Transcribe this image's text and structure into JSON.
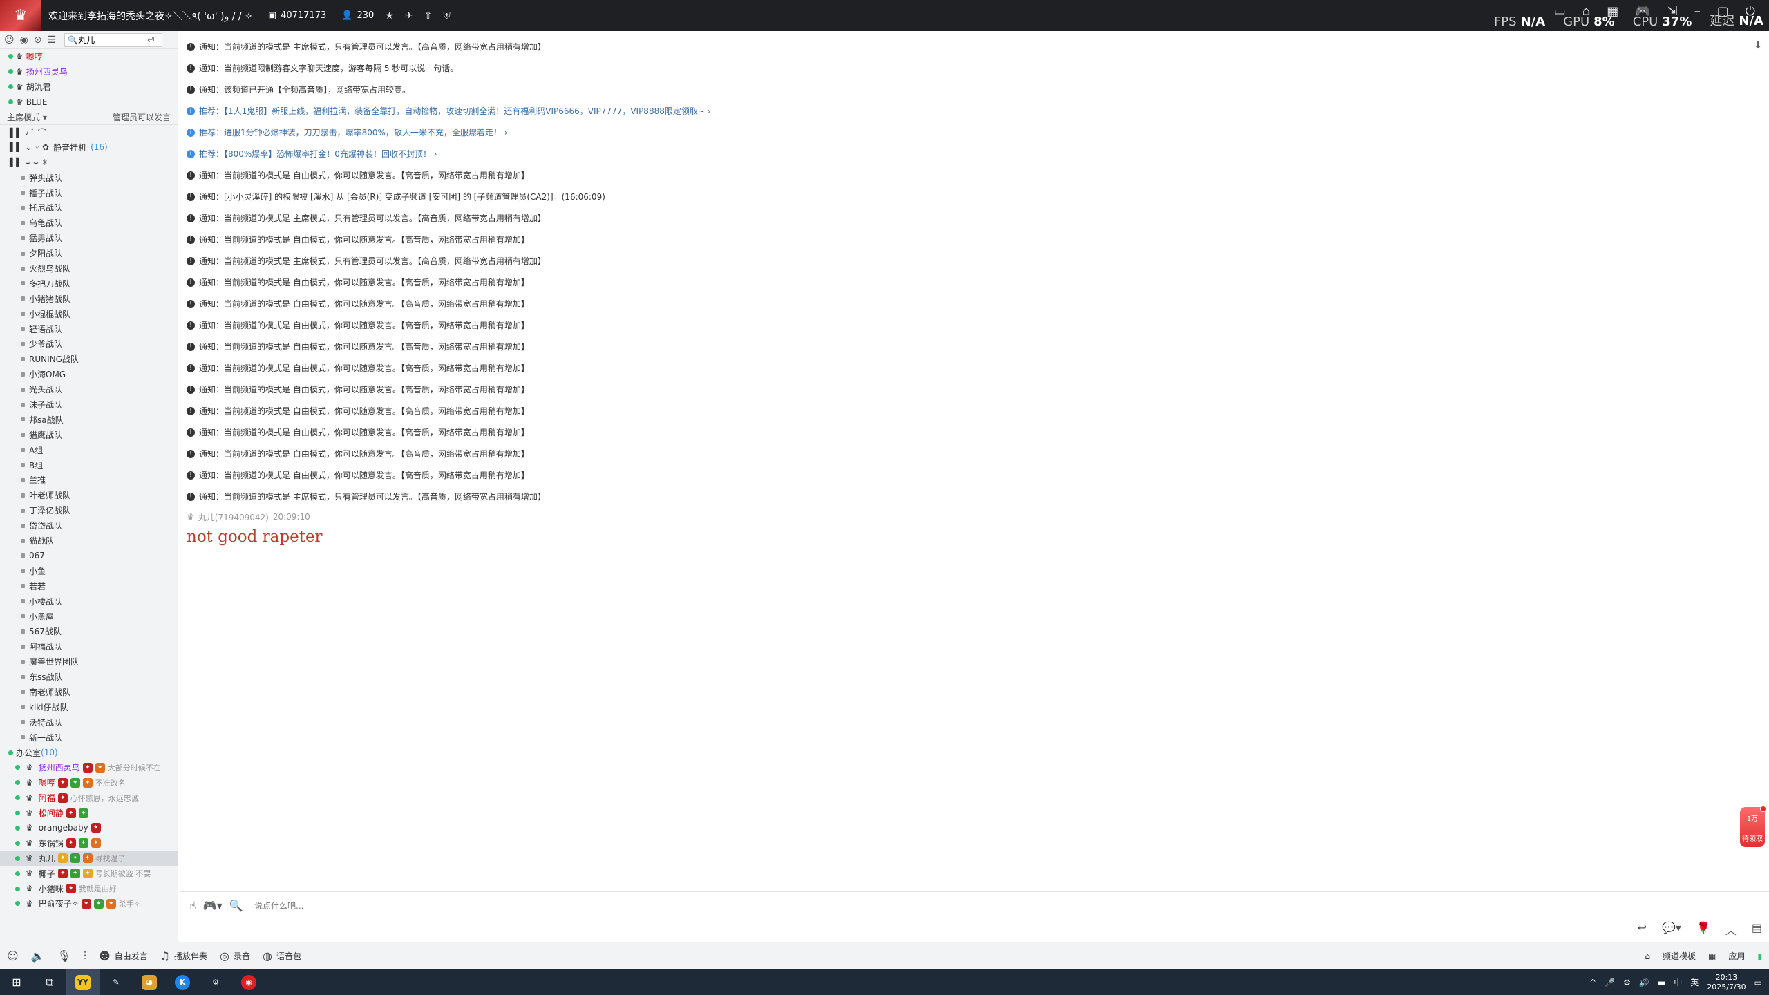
{
  "titlebar": {
    "title": "欢迎来到李拓海的秃头之夜✧＼＼٩( 'ω' )و / / ✧",
    "channel_id": "40717173",
    "online_count": "230",
    "perf": [
      {
        "label": "FPS",
        "value": "N/A"
      },
      {
        "label": "GPU",
        "value": "8%"
      },
      {
        "label": "CPU",
        "value": "37%"
      },
      {
        "label": "延迟",
        "value": "N/A"
      }
    ]
  },
  "sidebar": {
    "search_value": "丸儿",
    "top_users": [
      "嗯哼",
      "扬州西灵鸟",
      "胡氿君",
      "BLUE"
    ],
    "mode": {
      "label": "主席模式",
      "hint": "管理员可以发言"
    },
    "rooms": [
      {
        "label": "静音挂机",
        "count": "(16)"
      }
    ],
    "channels": [
      "弹头战队",
      "锤子战队",
      "托尼战队",
      "乌龟战队",
      "猛男战队",
      "夕阳战队",
      "火烈鸟战队",
      "多把刀战队",
      "小猪猪战队",
      "小棍棍战队",
      "轻语战队",
      "少爷战队",
      "RUNING战队",
      "小海OMG",
      "光头战队",
      "沫子战队",
      "邦sa战队",
      "猎鹰战队",
      "A组",
      "B组",
      "兰推",
      "叶老师战队",
      "丁泽亿战队",
      "岱岱战队",
      "猫战队",
      "067",
      "小鱼",
      "若若",
      "小楼战队",
      "小黑屋",
      "567战队",
      "阿福战队",
      "魔兽世界团队",
      "东ss战队",
      "南老师战队",
      "kiki仔战队",
      "沃特战队",
      "新一战队"
    ],
    "office": {
      "label": "办公室",
      "count": "(10)"
    },
    "members": [
      {
        "name": "扬州西灵鸟",
        "sig": "大部分时候不在"
      },
      {
        "name": "嗯哼",
        "sig": "不准改名"
      },
      {
        "name": "阿福",
        "sig": "心怀感恩，永远忠诚"
      },
      {
        "name": "松间静",
        "sig": ""
      },
      {
        "name": "orangebaby",
        "sig": ""
      },
      {
        "name": "东锅锅",
        "sig": ""
      },
      {
        "name": "丸儿",
        "sig": "寻找温了"
      },
      {
        "name": "椰子",
        "sig": "号长期被盗 不要"
      },
      {
        "name": "小猪咪",
        "sig": "我就是曲好"
      },
      {
        "name": "巴俞夜子✧",
        "sig": "杀手✧"
      }
    ]
  },
  "chat": {
    "messages": [
      {
        "type": "notice",
        "text": "通知：当前频道的模式是 主席模式，只有管理员可以发言。【高音质，网络带宽占用稍有增加】"
      },
      {
        "type": "notice",
        "text": "通知：当前频道限制游客文字聊天速度，游客每隔 5 秒可以说一句话。"
      },
      {
        "type": "notice",
        "text": "通知：该频道已开通【全频高音质】，网络带宽占用较高。"
      },
      {
        "type": "rec",
        "text": "推荐：【1人1鬼服】新服上线，福利拉满，装备全靠打，自动捡物，攻速切割全满！还有福利码VIP6666，VIP7777，VIP8888限定领取~ ›"
      },
      {
        "type": "rec",
        "text": "推荐：进服1分钟必爆神装，刀刀暴击，爆率800%，散人一米不充，全服爆着走！ ›"
      },
      {
        "type": "rec",
        "text": "推荐：【800%爆率】恐怖爆率打金！0充爆神装！回收不封顶！ ›"
      },
      {
        "type": "notice",
        "text": "通知：当前频道的模式是 自由模式，你可以随意发言。【高音质，网络带宽占用稍有增加】"
      },
      {
        "type": "notice",
        "text": "通知：[小小灵溪碎] 的权限被 [溪水] 从 [会员(R)] 变成子频道 [安可团] 的 [子频道管理员(CA2)]。(16:06:09)"
      },
      {
        "type": "notice",
        "text": "通知：当前频道的模式是 主席模式，只有管理员可以发言。【高音质，网络带宽占用稍有增加】"
      },
      {
        "type": "notice",
        "text": "通知：当前频道的模式是 自由模式，你可以随意发言。【高音质，网络带宽占用稍有增加】"
      },
      {
        "type": "notice",
        "text": "通知：当前频道的模式是 主席模式，只有管理员可以发言。【高音质，网络带宽占用稍有增加】"
      },
      {
        "type": "notice",
        "text": "通知：当前频道的模式是 自由模式，你可以随意发言。【高音质，网络带宽占用稍有增加】"
      },
      {
        "type": "notice",
        "text": "通知：当前频道的模式是 自由模式，你可以随意发言。【高音质，网络带宽占用稍有增加】"
      },
      {
        "type": "notice",
        "text": "通知：当前频道的模式是 自由模式，你可以随意发言。【高音质，网络带宽占用稍有增加】"
      },
      {
        "type": "notice",
        "text": "通知：当前频道的模式是 自由模式，你可以随意发言。【高音质，网络带宽占用稍有增加】"
      },
      {
        "type": "notice",
        "text": "通知：当前频道的模式是 自由模式，你可以随意发言。【高音质，网络带宽占用稍有增加】"
      },
      {
        "type": "notice",
        "text": "通知：当前频道的模式是 自由模式，你可以随意发言。【高音质，网络带宽占用稍有增加】"
      },
      {
        "type": "notice",
        "text": "通知：当前频道的模式是 自由模式，你可以随意发言。【高音质，网络带宽占用稍有增加】"
      },
      {
        "type": "notice",
        "text": "通知：当前频道的模式是 自由模式，你可以随意发言。【高音质，网络带宽占用稍有增加】"
      },
      {
        "type": "notice",
        "text": "通知：当前频道的模式是 自由模式，你可以随意发言。【高音质，网络带宽占用稍有增加】"
      },
      {
        "type": "notice",
        "text": "通知：当前频道的模式是 自由模式，你可以随意发言。【高音质，网络带宽占用稍有增加】"
      },
      {
        "type": "notice",
        "text": "通知：当前频道的模式是 主席模式，只有管理员可以发言。【高音质，网络带宽占用稍有增加】"
      }
    ],
    "user_message": {
      "sender": "丸儿(719409042)",
      "time": "20:09:10",
      "text": "not good rapeter"
    }
  },
  "gift": {
    "line1": "1万",
    "line2": "待领取"
  },
  "input": {
    "placeholder": "说点什么吧..."
  },
  "bottombar": {
    "free_speak": "自由发言",
    "play_music": "播放伴奏",
    "record": "录音",
    "voice_pack": "语音包",
    "channel_template": "频道模板",
    "apps": "应用"
  },
  "taskbar": {
    "ime": "英",
    "time": "20:13",
    "date": "2025/7/30"
  }
}
